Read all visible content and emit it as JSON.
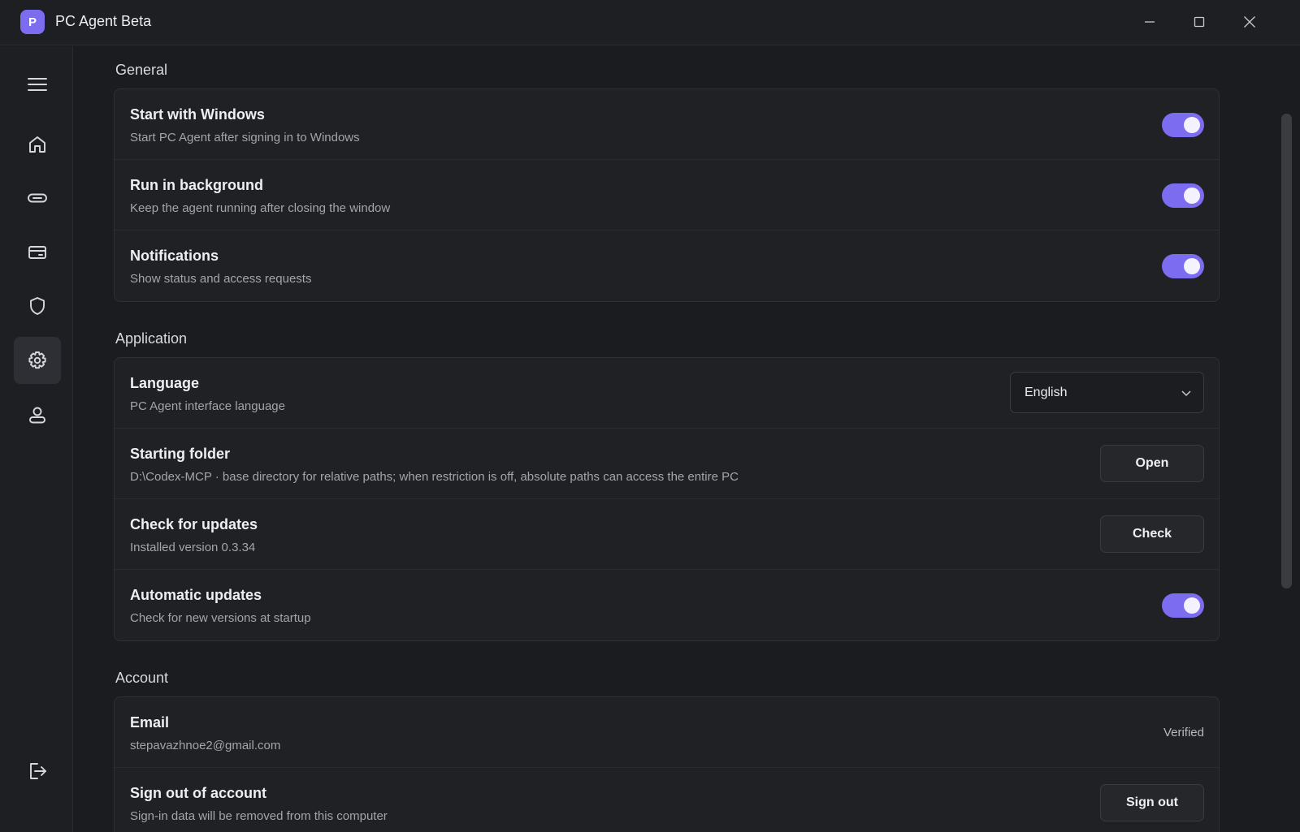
{
  "window": {
    "logo_letter": "P",
    "title": "PC Agent Beta"
  },
  "sidebar": {
    "items": [
      {
        "icon": "menu-icon"
      },
      {
        "icon": "home-icon"
      },
      {
        "icon": "link-icon"
      },
      {
        "icon": "card-icon"
      },
      {
        "icon": "shield-icon"
      },
      {
        "icon": "gear-icon",
        "active": true
      },
      {
        "icon": "user-icon"
      },
      {
        "icon": "logout-icon"
      }
    ]
  },
  "general": {
    "title": "General",
    "rows": [
      {
        "title": "Start with Windows",
        "desc": "Start PC Agent after signing in to Windows",
        "enabled": true
      },
      {
        "title": "Run in background",
        "desc": "Keep the agent running after closing the window",
        "enabled": true
      },
      {
        "title": "Notifications",
        "desc": "Show status and access requests",
        "enabled": true
      }
    ]
  },
  "application": {
    "title": "Application",
    "language": {
      "title": "Language",
      "desc": "PC Agent interface language",
      "value": "English"
    },
    "starting_folder": {
      "title": "Starting folder",
      "desc": "D:\\Codex-MCP · base directory for relative paths; when restriction is off, absolute paths can access the entire PC",
      "button": "Open"
    },
    "check_updates": {
      "title": "Check for updates",
      "desc": "Installed version 0.3.34",
      "button": "Check"
    },
    "auto_updates": {
      "title": "Automatic updates",
      "desc": "Check for new versions at startup",
      "enabled": true
    }
  },
  "account": {
    "title": "Account",
    "email": {
      "title": "Email",
      "value": "stepavazhnoe2@gmail.com",
      "status": "Verified"
    },
    "sign_out": {
      "title": "Sign out of account",
      "desc": "Sign-in data will be removed from this computer",
      "button": "Sign out"
    }
  },
  "colors": {
    "accent": "#7b6cf0",
    "background": "#1b1c1f",
    "card": "#202125"
  }
}
